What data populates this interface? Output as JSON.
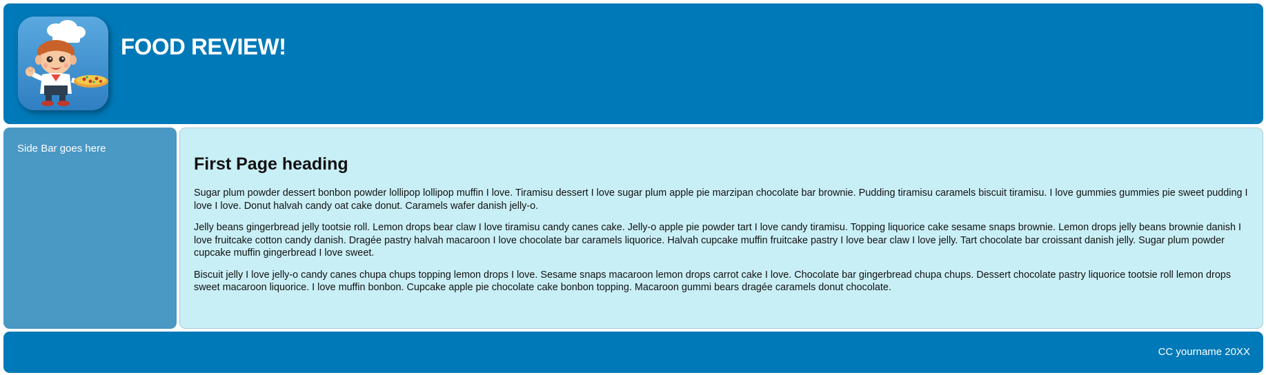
{
  "header": {
    "site_title": "FOOD REVIEW!",
    "logo_icon": "chef-holding-pizza-icon"
  },
  "sidebar": {
    "text": "Side Bar goes here"
  },
  "main": {
    "heading": "First Page heading",
    "paragraphs": [
      "Sugar plum powder dessert bonbon powder lollipop lollipop muffin I love. Tiramisu dessert I love sugar plum apple pie marzipan chocolate bar brownie. Pudding tiramisu caramels biscuit tiramisu. I love gummies gummies pie sweet pudding I love I love. Donut halvah candy oat cake donut. Caramels wafer danish jelly-o.",
      "Jelly beans gingerbread jelly tootsie roll. Lemon drops bear claw I love tiramisu candy canes cake. Jelly-o apple pie powder tart I love candy tiramisu. Topping liquorice cake sesame snaps brownie. Lemon drops jelly beans brownie danish I love fruitcake cotton candy danish. Dragée pastry halvah macaroon I love chocolate bar caramels liquorice. Halvah cupcake muffin fruitcake pastry I love bear claw I love jelly. Tart chocolate bar croissant danish jelly. Sugar plum powder cupcake muffin gingerbread I love sweet.",
      "Biscuit jelly I love jelly-o candy canes chupa chups topping lemon drops I love. Sesame snaps macaroon lemon drops carrot cake I love. Chocolate bar gingerbread chupa chups. Dessert chocolate pastry liquorice tootsie roll lemon drops sweet macaroon liquorice. I love muffin bonbon. Cupcake apple pie chocolate cake bonbon topping. Macaroon gummi bears dragée caramels donut chocolate."
    ]
  },
  "footer": {
    "text": "CC yourname 20XX"
  },
  "colors": {
    "header_bg": "#0079b8",
    "sidebar_bg": "#4a98c4",
    "main_bg": "#c9eff6",
    "footer_bg": "#0079b8"
  }
}
